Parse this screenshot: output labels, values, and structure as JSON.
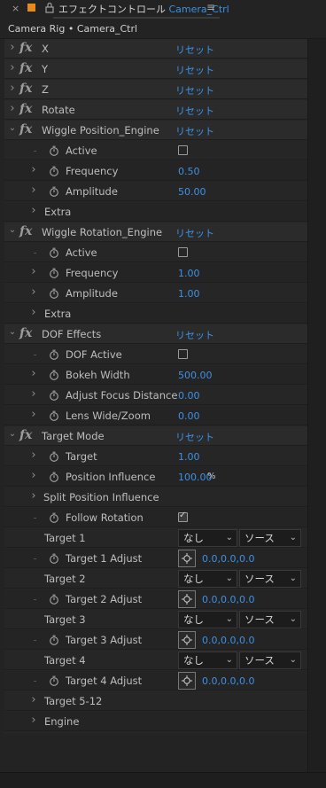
{
  "tab": {
    "close": "×",
    "title": "エフェクトコントロール",
    "layer": "Camera_Ctrl",
    "menu": "≡"
  },
  "breadcrumb": "Camera Rig • Camera_Ctrl",
  "reset_label": "リセット",
  "effects_simple": [
    {
      "name": "X"
    },
    {
      "name": "Y"
    },
    {
      "name": "Z"
    },
    {
      "name": "Rotate"
    }
  ],
  "wiggle_position": {
    "name": "Wiggle Position_Engine",
    "active": "Active",
    "frequency": "Frequency",
    "frequency_value": "0.50",
    "amplitude": "Amplitude",
    "amplitude_value": "50.00",
    "extra": "Extra"
  },
  "wiggle_rotation": {
    "name": "Wiggle Rotation_Engine",
    "active": "Active",
    "frequency": "Frequency",
    "frequency_value": "1.00",
    "amplitude": "Amplitude",
    "amplitude_value": "1.00",
    "extra": "Extra"
  },
  "dof": {
    "name": "DOF Effects",
    "active": "DOF Active",
    "bokeh": "Bokeh Width",
    "bokeh_value": "500.00",
    "focus": "Adjust Focus Distance",
    "focus_value": "0.00",
    "lens": "Lens Wide/Zoom",
    "lens_value": "0.00"
  },
  "target_mode": {
    "name": "Target Mode",
    "target": "Target",
    "target_value": "1.00",
    "pos_influence": "Position Influence",
    "pos_influence_value": "100.00",
    "pos_influence_unit": "%",
    "split": "Split Position Influence",
    "follow_rotation": "Follow Rotation",
    "targets": [
      {
        "label": "Target 1",
        "adjust": "Target 1 Adjust",
        "layer": "なし",
        "source": "ソース",
        "point": "0.0,0.0,0.0"
      },
      {
        "label": "Target 2",
        "adjust": "Target 2 Adjust",
        "layer": "なし",
        "source": "ソース",
        "point": "0.0,0.0,0.0"
      },
      {
        "label": "Target 3",
        "adjust": "Target 3 Adjust",
        "layer": "なし",
        "source": "ソース",
        "point": "0.0,0.0,0.0"
      },
      {
        "label": "Target 4",
        "adjust": "Target 4 Adjust",
        "layer": "なし",
        "source": "ソース",
        "point": "0.0,0.0,0.0"
      }
    ],
    "target_5_12": "Target 5-12",
    "engine": "Engine"
  },
  "colors": {
    "accent_blue": "#3c91e6",
    "swatch_orange": "#e8891c",
    "panel_bg": "#262626"
  }
}
